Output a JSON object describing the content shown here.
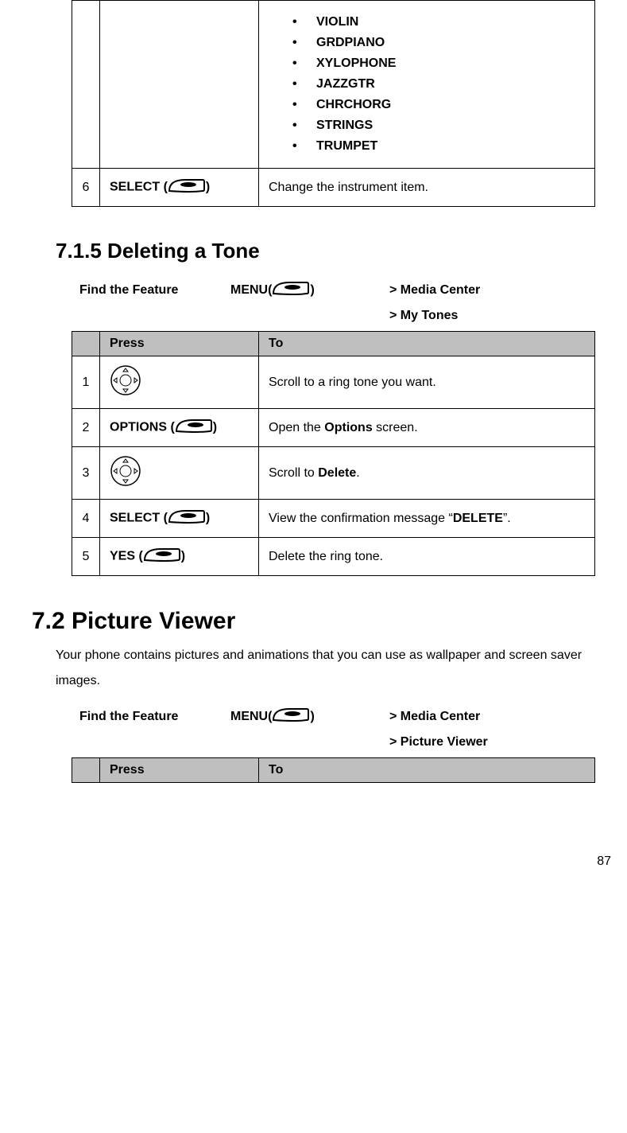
{
  "table1": {
    "instruments": [
      "VIOLIN",
      "GRDPIANO",
      "XYLOPHONE",
      "JAZZGTR",
      "CHRCHORG",
      "STRINGS",
      "TRUMPET"
    ],
    "row6": {
      "num": "6",
      "press_label": "SELECT",
      "to": "Change the instrument item."
    }
  },
  "section_715": {
    "heading": "7.1.5    Deleting a Tone",
    "ff_label": "Find the Feature",
    "ff_menu": "MENU",
    "ff_path1": "> Media Center",
    "ff_path2": "> My Tones",
    "header_press": "Press",
    "header_to": "To",
    "rows": [
      {
        "num": "1",
        "press_label": "",
        "icon": "nav",
        "to_pre": "Scroll to a ring tone you want.",
        "to_bold": "",
        "to_post": ""
      },
      {
        "num": "2",
        "press_label": "OPTIONS",
        "icon": "softkey",
        "to_pre": "Open the ",
        "to_bold": "Options",
        "to_post": " screen."
      },
      {
        "num": "3",
        "press_label": "",
        "icon": "nav",
        "to_pre": "Scroll to ",
        "to_bold": "Delete",
        "to_post": "."
      },
      {
        "num": "4",
        "press_label": "SELECT",
        "icon": "softkey",
        "to_pre": "View the confirmation message “",
        "to_bold": "DELETE",
        "to_post": "”."
      },
      {
        "num": "5",
        "press_label": "YES",
        "icon": "softkey",
        "to_pre": "Delete the ring tone.",
        "to_bold": "",
        "to_post": ""
      }
    ]
  },
  "chapter_72": {
    "heading": "7.2  Picture Viewer",
    "body": "Your phone contains pictures and animations that you can use as wallpaper and screen saver images.",
    "ff_label": "Find the Feature",
    "ff_menu": "MENU",
    "ff_path1": "> Media Center",
    "ff_path2": "> Picture Viewer",
    "header_press": "Press",
    "header_to": "To"
  },
  "page_number": "87"
}
